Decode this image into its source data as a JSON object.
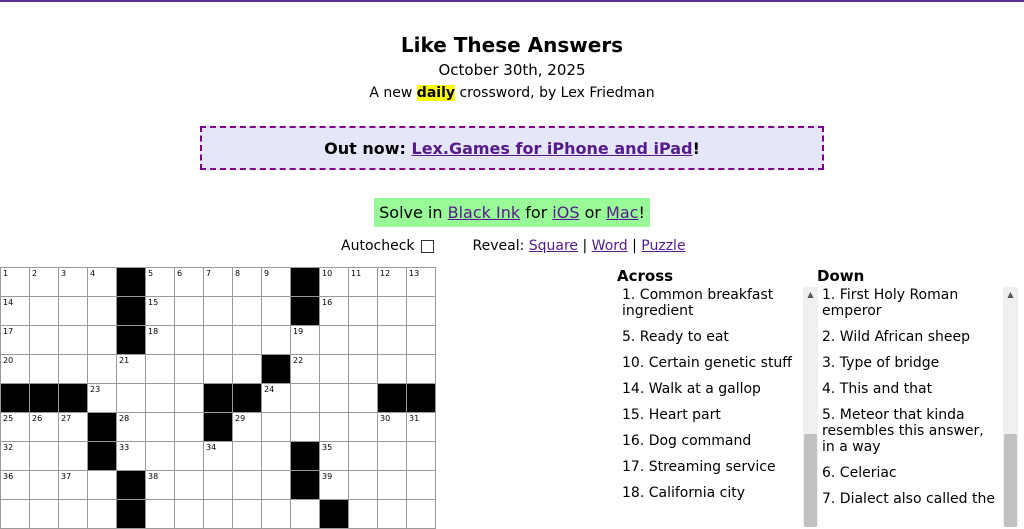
{
  "header": {
    "title": "Like These Answers",
    "date": "October 30th, 2025",
    "subtitle_before": "A new",
    "subtitle_highlight": "daily",
    "subtitle_after": "crossword, by Lex Friedman"
  },
  "promo": {
    "lead": "Out now:",
    "link": "Lex.Games for iPhone and iPad",
    "trail": "!"
  },
  "solve": {
    "lead": "Solve in",
    "app_link": "Black Ink",
    "mid": "for",
    "ios_link": "iOS",
    "or": "or",
    "mac_link": "Mac",
    "trail": "!"
  },
  "controls": {
    "autocheck_label": "Autocheck",
    "reveal_label": "Reveal:",
    "reveal_square": "Square",
    "reveal_word": "Word",
    "reveal_puzzle": "Puzzle",
    "separator": "|"
  },
  "grid": {
    "rows": [
      [
        {
          "n": "1"
        },
        {
          "n": "2"
        },
        {
          "n": "3"
        },
        {
          "n": "4"
        },
        {
          "b": true
        },
        {
          "n": "5"
        },
        {
          "n": "6"
        },
        {
          "n": "7"
        },
        {
          "n": "8"
        },
        {
          "n": "9"
        },
        {
          "b": true
        },
        {
          "n": "10"
        },
        {
          "n": "11"
        },
        {
          "n": "12"
        },
        {
          "n": "13"
        }
      ],
      [
        {
          "n": "14"
        },
        {},
        {},
        {},
        {
          "b": true
        },
        {
          "n": "15"
        },
        {},
        {},
        {},
        {},
        {
          "b": true
        },
        {
          "n": "16"
        },
        {},
        {},
        {}
      ],
      [
        {
          "n": "17"
        },
        {},
        {},
        {},
        {
          "b": true
        },
        {
          "n": "18"
        },
        {},
        {},
        {},
        {},
        {
          "n": "19"
        },
        {},
        {},
        {},
        {}
      ],
      [
        {
          "n": "20"
        },
        {},
        {},
        {},
        {
          "n": "21"
        },
        {},
        {},
        {},
        {},
        {
          "b": true
        },
        {
          "n": "22"
        },
        {},
        {},
        {},
        {}
      ],
      [
        {
          "b": true
        },
        {
          "b": true
        },
        {
          "b": true
        },
        {
          "n": "23"
        },
        {},
        {},
        {},
        {
          "b": true
        },
        {
          "b": true
        },
        {
          "n": "24"
        },
        {},
        {},
        {},
        {
          "b": true
        },
        {
          "b": true
        }
      ],
      [
        {
          "n": "25"
        },
        {
          "n": "26"
        },
        {
          "n": "27"
        },
        {
          "b": true
        },
        {
          "n": "28"
        },
        {},
        {},
        {
          "b": true
        },
        {
          "n": "29"
        },
        {},
        {},
        {},
        {},
        {
          "n": "30"
        },
        {
          "n": "31"
        }
      ],
      [
        {
          "n": "32"
        },
        {},
        {},
        {
          "b": true
        },
        {
          "n": "33"
        },
        {},
        {},
        {
          "n": "34"
        },
        {},
        {},
        {
          "b": true
        },
        {
          "n": "35"
        },
        {},
        {},
        {}
      ],
      [
        {
          "n": "36"
        },
        {},
        {
          "n": "37"
        },
        {},
        {
          "b": true
        },
        {
          "n": "38"
        },
        {},
        {},
        {},
        {},
        {
          "b": true
        },
        {
          "n": "39"
        },
        {},
        {},
        {}
      ],
      [
        {},
        {},
        {},
        {},
        {
          "b": true
        },
        {},
        {},
        {},
        {},
        {},
        {},
        {
          "b": true
        },
        {},
        {},
        {}
      ]
    ]
  },
  "across": {
    "heading": "Across",
    "clues": [
      "1. Common breakfast ingredient",
      "5. Ready to eat",
      "10. Certain genetic stuff",
      "14. Walk at a gallop",
      "15. Heart part",
      "16. Dog command",
      "17. Streaming service",
      "18. California city"
    ]
  },
  "down": {
    "heading": "Down",
    "clues": [
      "1. First Holy Roman emperor",
      "2. Wild African sheep",
      "3. Type of bridge",
      "4. This and that",
      "5. Meteor that kinda resembles this answer, in a way",
      "6. Celeriac",
      "7. Dialect also called the"
    ]
  }
}
